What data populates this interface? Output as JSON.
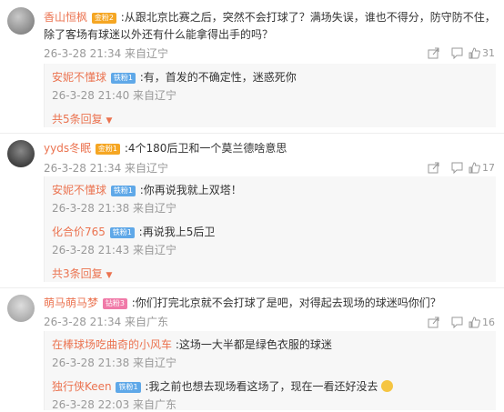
{
  "comments": [
    {
      "user": "香山恒枫",
      "badge": "金粉2",
      "text": ":从跟北京比赛之后，突然不会打球了？满场失误，谁也不得分，防守防不住，",
      "text2": "除了客场有球迷以外还有什么能拿得出手的吗？",
      "meta": "26-3-28 21:34 来自辽宁",
      "likes": "31",
      "replies": [
        {
          "user": "安妮不懂球",
          "badge": "铁粉1",
          "text": ":有，首发的不确定性，迷惑死你",
          "meta": "26-3-28 21:40 来自辽宁"
        }
      ],
      "more": "共5条回复"
    },
    {
      "user": "yyds冬眠",
      "badge": "金粉1",
      "text": ":4个180后卫和一个莫兰德啥意思",
      "meta": "26-3-28 21:34 来自辽宁",
      "likes": "17",
      "replies": [
        {
          "user": "安妮不懂球",
          "badge": "铁粉1",
          "text": ":你再说我就上双塔！",
          "meta": "26-3-28 21:38 来自辽宁"
        },
        {
          "user": "化合价765",
          "badge": "铁粉1",
          "text": ":再说我上5后卫",
          "meta": "26-3-28 21:43 来自辽宁"
        }
      ],
      "more": "共3条回复"
    },
    {
      "user": "萌马萌马梦",
      "badge": "钻粉3",
      "text": ":你们打完北京就不会打球了是吧，对得起去现场的球迷吗你们？",
      "meta": "26-3-28 21:34 来自广东",
      "likes": "16",
      "replies": [
        {
          "user": "在棒球场吃曲奇的小风车",
          "badge": "",
          "text": ":这场一大半都是绿色衣服的球迷",
          "meta": "26-3-28 21:38 来自辽宁"
        },
        {
          "user": "独行侠Keen",
          "badge": "铁粉1",
          "text": ":我之前也想去现场看这场了，现在一看还好没去",
          "meta": "26-3-28 22:03 来自广东"
        }
      ]
    }
  ],
  "icons": [
    "share-icon",
    "comment-icon",
    "like-icon"
  ],
  "colors": {
    "username": "#eb7350",
    "meta": "#999999",
    "reply_bg": "#f7f7f7"
  }
}
